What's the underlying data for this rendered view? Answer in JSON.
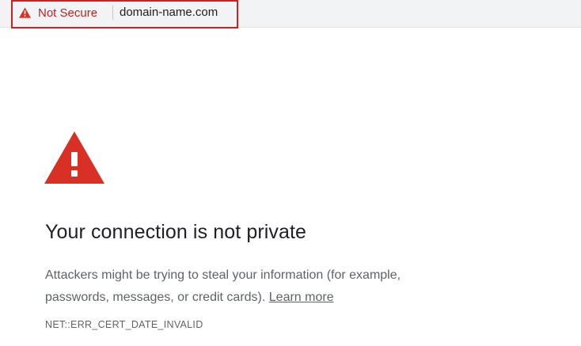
{
  "address_bar": {
    "security_label": "Not Secure",
    "url": "domain-name.com"
  },
  "interstitial": {
    "heading": "Your connection is not private",
    "body": "Attackers might be trying to steal your information  (for example, passwords, messages, or credit cards).",
    "learn_more": "Learn more",
    "error_code": "NET::ERR_CERT_DATE_INVALID"
  },
  "colors": {
    "warning_red": "#d93025",
    "security_text": "#c5221f",
    "highlight_border": "#d11f1f",
    "heading_text": "#202124",
    "body_text": "#5f6368"
  },
  "icons": {
    "security_icon": "warning-triangle-icon",
    "main_icon": "warning-triangle-icon"
  }
}
